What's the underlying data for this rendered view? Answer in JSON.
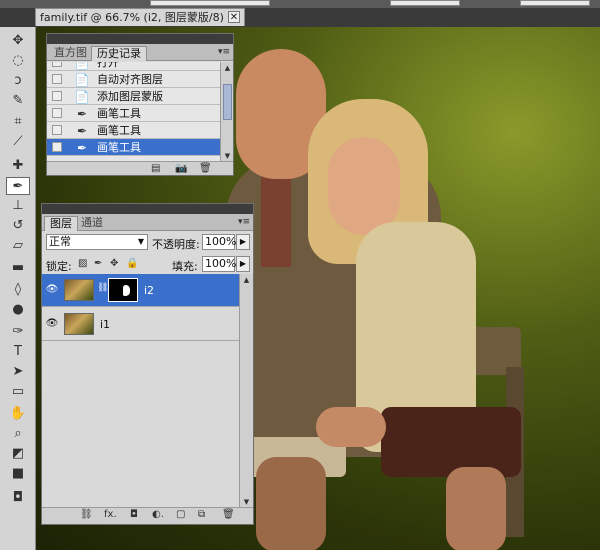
{
  "document_tab": {
    "title": "family.tif @ 66.7% (i2, 图层蒙版/8) *",
    "close_glyph": "✕"
  },
  "tools": [
    {
      "name": "move-tool-icon",
      "glyph": "✥"
    },
    {
      "name": "marquee-tool-icon",
      "glyph": "◌"
    },
    {
      "name": "lasso-tool-icon",
      "glyph": "ↄ"
    },
    {
      "name": "quick-select-tool-icon",
      "glyph": "✎"
    },
    {
      "name": "crop-tool-icon",
      "glyph": "⌗"
    },
    {
      "name": "eyedropper-tool-icon",
      "glyph": "⟋"
    },
    {
      "name": "healing-brush-tool-icon",
      "glyph": "✚"
    },
    {
      "name": "brush-tool-icon",
      "glyph": "✒"
    },
    {
      "name": "clone-stamp-tool-icon",
      "glyph": "⊥"
    },
    {
      "name": "history-brush-tool-icon",
      "glyph": "↺"
    },
    {
      "name": "eraser-tool-icon",
      "glyph": "▱"
    },
    {
      "name": "gradient-tool-icon",
      "glyph": "▬"
    },
    {
      "name": "blur-tool-icon",
      "glyph": "◊"
    },
    {
      "name": "dodge-tool-icon",
      "glyph": "●"
    },
    {
      "name": "pen-tool-icon",
      "glyph": "✑"
    },
    {
      "name": "type-tool-icon",
      "glyph": "T"
    },
    {
      "name": "path-select-tool-icon",
      "glyph": "➤"
    },
    {
      "name": "shape-tool-icon",
      "glyph": "▭"
    },
    {
      "name": "hand-tool-icon",
      "glyph": "✋"
    },
    {
      "name": "zoom-tool-icon",
      "glyph": "⌕"
    },
    {
      "name": "default-colors-icon",
      "glyph": "◩"
    },
    {
      "name": "color-swatches-icon",
      "glyph": "■"
    },
    {
      "name": "quick-mask-icon",
      "glyph": "◘"
    }
  ],
  "history_panel": {
    "tabs": [
      "直方图",
      "历史记录"
    ],
    "active_tab": 1,
    "menu_glyph": "▾≡",
    "collapse_glyph": "◂◂",
    "close_glyph": "✕",
    "items": [
      {
        "label": "打开",
        "icon": "📄",
        "selected": false
      },
      {
        "label": "自动对齐图层",
        "icon": "📄",
        "selected": false
      },
      {
        "label": "添加图层蒙版",
        "icon": "📄",
        "selected": false
      },
      {
        "label": "画笔工具",
        "icon": "✒",
        "selected": false
      },
      {
        "label": "画笔工具",
        "icon": "✒",
        "selected": false
      },
      {
        "label": "画笔工具",
        "icon": "✒",
        "selected": true
      }
    ],
    "footer_icons": [
      "▤",
      "📷",
      "🗑"
    ]
  },
  "layers_panel": {
    "tabs": [
      "图层",
      "通道"
    ],
    "active_tab": 0,
    "menu_glyph": "▾≡",
    "close_glyph": "✕",
    "blend_mode": "正常",
    "opacity_label": "不透明度:",
    "opacity_value": "100%",
    "lock_label": "锁定:",
    "lock_icons": [
      "▨",
      "✒",
      "✥",
      "🔒"
    ],
    "fill_label": "填充:",
    "fill_value": "100%",
    "layers": [
      {
        "name": "i2",
        "visible": true,
        "has_mask": true,
        "selected": true
      },
      {
        "name": "i1",
        "visible": true,
        "has_mask": false,
        "selected": false
      }
    ],
    "footer_icons": [
      "⛓",
      "fx.",
      "◘",
      "◐.",
      "▢",
      "⧉",
      "🗑"
    ],
    "eye_glyph": "👁"
  },
  "colors": {
    "selection_blue": "#3b6fcc",
    "panel_gray": "#d9d9d9",
    "canvas_foliage": "#4f5d14"
  }
}
